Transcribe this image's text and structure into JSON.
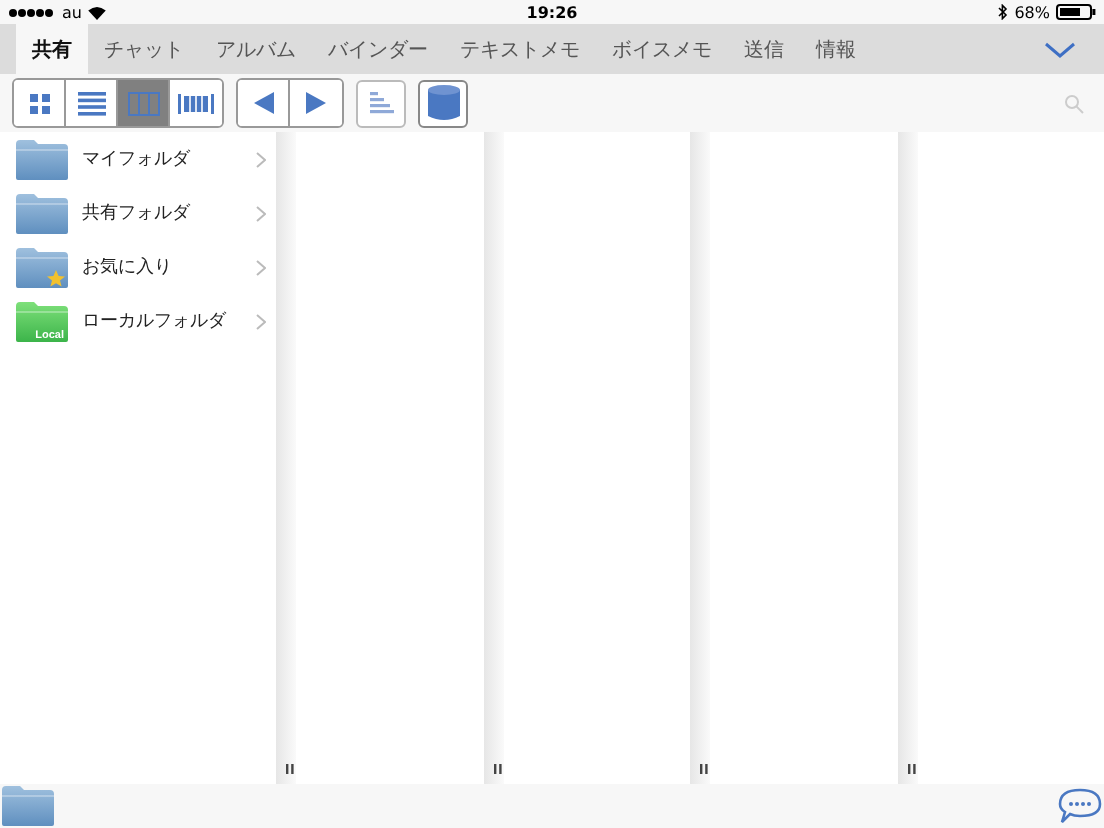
{
  "status_bar": {
    "carrier": "au",
    "time": "19:26",
    "battery": "68%"
  },
  "tabs": [
    {
      "label": "共有",
      "selected": true
    },
    {
      "label": "チャット",
      "selected": false
    },
    {
      "label": "アルバム",
      "selected": false
    },
    {
      "label": "バインダー",
      "selected": false
    },
    {
      "label": "テキストメモ",
      "selected": false
    },
    {
      "label": "ボイスメモ",
      "selected": false
    },
    {
      "label": "送信",
      "selected": false
    },
    {
      "label": "情報",
      "selected": false
    }
  ],
  "view_modes": [
    {
      "kind": "grid",
      "selected": false
    },
    {
      "kind": "list",
      "selected": false
    },
    {
      "kind": "columns",
      "selected": true
    },
    {
      "kind": "filmstrip",
      "selected": false
    }
  ],
  "folders": [
    {
      "label": "マイフォルダ",
      "kind": "plain"
    },
    {
      "label": "共有フォルダ",
      "kind": "plain"
    },
    {
      "label": "お気に入り",
      "kind": "favorite"
    },
    {
      "label": "ローカルフォルダ",
      "kind": "local",
      "badge": "Local"
    }
  ]
}
